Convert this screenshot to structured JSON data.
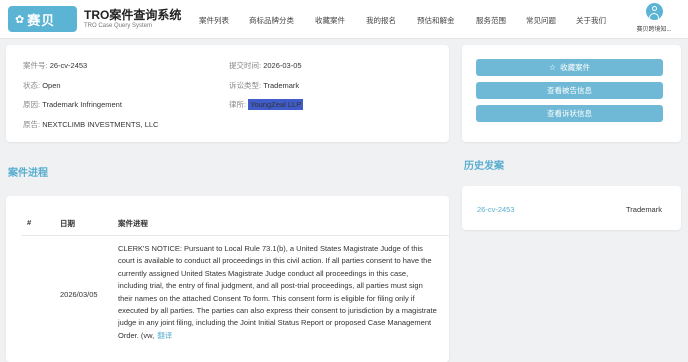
{
  "header": {
    "logo_mark": "✿",
    "logo_text": "赛贝",
    "brand_title": "TRO案件查询系统",
    "brand_subtitle": "TRO Case Query System",
    "nav": [
      "案件列表",
      "商标品牌分类",
      "收藏案件",
      "我的报名",
      "预估和解金",
      "服务范围",
      "常见问题",
      "关于我们"
    ],
    "user_name": "赛贝跨境知..."
  },
  "info": {
    "case_no_label": "案件号:",
    "case_no": "26-cv-2453",
    "submit_label": "提交时间:",
    "submit_date": "2026-03-05",
    "status_label": "状态:",
    "status": "Open",
    "type_label": "诉讼类型:",
    "type": "Trademark",
    "cause_label": "原因:",
    "cause": "Trademark Infringement",
    "lawyer_label": "律所:",
    "lawyer": "YoungZeal LLP",
    "plaintiff_label": "原告:",
    "plaintiff": "NEXTCLIMB INVESTMENTS, LLC"
  },
  "actions": {
    "favorite": "收藏案件",
    "defendant_info": "查看被告信息",
    "litigation_info": "查看诉状信息"
  },
  "progress": {
    "title": "案件进程",
    "col_index": "#",
    "col_date": "日期",
    "col_progress": "案件进程",
    "rows": [
      {
        "date": "2026/03/05",
        "text": "CLERK'S NOTICE: Pursuant to Local Rule 73.1(b), a United States Magistrate Judge of this court is available to conduct all proceedings in this civil action. If all parties consent to have the currently assigned United States Magistrate Judge conduct all proceedings in this case, including trial, the entry of final judgment, and all post-trial proceedings, all parties must sign their names on the attached Consent To form. This consent form is eligible for filing only if executed by all parties. The parties can also express their consent to jurisdiction by a magistrate judge in any joint filing, including the Joint Initial Status Report or proposed Case Management Order. (vw,",
        "translate": "翻译"
      }
    ]
  },
  "history": {
    "title": "历史发案",
    "items": [
      {
        "case_no": "26-cv-2453",
        "type": "Trademark"
      }
    ]
  },
  "colors": {
    "accent": "#5bb4d4",
    "button": "#6fb9d6",
    "law_tag": "#3f5cc9"
  }
}
